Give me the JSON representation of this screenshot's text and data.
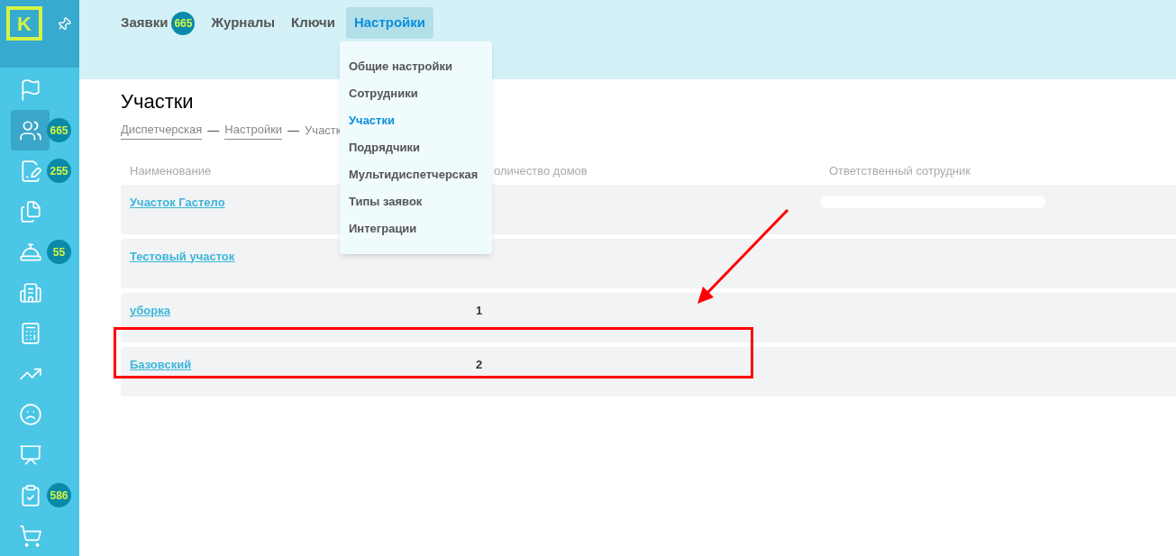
{
  "logo": {
    "letter": "K"
  },
  "sidebar": {
    "items": [
      {
        "selected": false
      },
      {
        "selected": true,
        "badge": "665"
      },
      {
        "selected": false,
        "badge": "255"
      },
      {
        "selected": false
      },
      {
        "selected": false,
        "badge": "55"
      },
      {
        "selected": false
      },
      {
        "selected": false
      },
      {
        "selected": false
      },
      {
        "selected": false
      },
      {
        "selected": false
      },
      {
        "selected": false,
        "badge": "586"
      },
      {
        "selected": false
      }
    ]
  },
  "top_nav": [
    {
      "label": "Заявки",
      "badge": "665",
      "selected": false
    },
    {
      "label": "Журналы",
      "selected": false
    },
    {
      "label": "Ключи",
      "selected": false
    },
    {
      "label": "Настройки",
      "selected": true
    }
  ],
  "dropdown": [
    {
      "label": "Общие настройки",
      "selected": false
    },
    {
      "label": "Сотрудники",
      "selected": false
    },
    {
      "label": "Участки",
      "selected": true
    },
    {
      "label": "Подрядчики",
      "selected": false
    },
    {
      "label": "Мультидиспетчерская",
      "selected": false
    },
    {
      "label": "Типы заявок",
      "selected": false
    },
    {
      "label": "Интеграции",
      "selected": false
    }
  ],
  "page_title": "Участки",
  "breadcrumb_separator": "—",
  "breadcrumbs": [
    {
      "label": "Диспетчерская",
      "kind": "link"
    },
    {
      "label": "Настройки",
      "kind": "link"
    },
    {
      "label": "Участк",
      "kind": "current"
    }
  ],
  "table": {
    "columns": [
      "Наименование",
      "оличество домов",
      "Ответственный сотрудник"
    ],
    "rows": [
      {
        "name": "Участок Гастело",
        "redacted": true
      },
      {
        "name": "Тестовый участок",
        "redacted": false
      },
      {
        "name": "уборка",
        "count": "1",
        "redacted": false
      },
      {
        "name": "Базовский",
        "count": "2",
        "redacted": false
      }
    ]
  }
}
